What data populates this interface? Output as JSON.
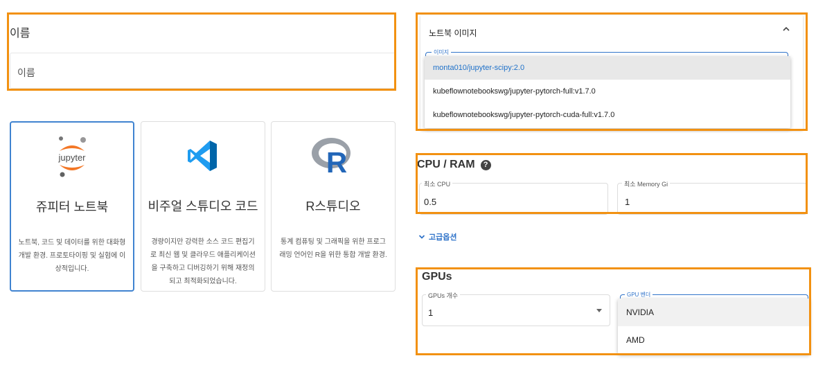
{
  "name_section": {
    "title": "이름",
    "input_placeholder": "이름"
  },
  "cards": [
    {
      "logo_text": "jupyter",
      "title": "쥬피터 노트북",
      "description": "노트북, 코드 및 데이터를 위한 대화형 개발 환경. 프로토타이핑 및 실험에 이상적입니다."
    },
    {
      "title": "비주얼 스튜디오 코드",
      "description": "경량이지만 강력한 소스 코드 편집기로 최신 웹 및 클라우드 애플리케이션을 구축하고 디버깅하기 위해 재정의되고 최적화되었습니다."
    },
    {
      "logo_text": "R",
      "title": "R스튜디오",
      "description": "통계 컴퓨팅 및 그래픽을 위한 프로그래밍 언어인 R을 위한 통합 개발 환경."
    }
  ],
  "notebook_image": {
    "title": "노트북 이미지",
    "field_label": "이미지",
    "options": [
      "monta010/jupyter-scipy:2.0",
      "kubeflownotebookswg/jupyter-pytorch-full:v1.7.0",
      "kubeflownotebookswg/jupyter-pytorch-cuda-full:v1.7.0"
    ],
    "selected_index": 0
  },
  "cpu_ram": {
    "title": "CPU / RAM",
    "help_icon": "?",
    "cpu_label": "최소 CPU",
    "cpu_value": "0.5",
    "memory_label": "최소 Memory Gi",
    "memory_value": "1"
  },
  "advanced": {
    "label": "고급옵션"
  },
  "gpus": {
    "title": "GPUs",
    "count_label": "GPUs 개수",
    "count_value": "1",
    "vendor_label": "GPU 벤더",
    "vendor_options": [
      "NVIDIA",
      "AMD"
    ],
    "selected_index": 0
  },
  "colors": {
    "highlight_border": "#f29111",
    "accent_blue": "#2f73c9",
    "selected_card_border": "#3f83d0"
  }
}
